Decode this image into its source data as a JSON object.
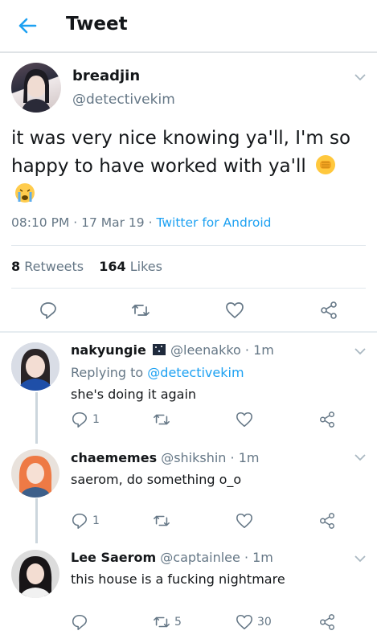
{
  "header": {
    "title": "Tweet"
  },
  "main_tweet": {
    "display_name": "breadjin",
    "handle": "@detectivekim",
    "text": "it was very nice knowing ya'll, I'm so happy to have worked with ya'll",
    "timestamp": "08:10 PM · 17 Mar 19 · ",
    "source": "Twitter for Android",
    "retweets_count": "8",
    "retweets_label": " Retweets",
    "likes_count": "164",
    "likes_label": " Likes",
    "emojis": [
      "fist-emoji",
      "crying-emoji"
    ]
  },
  "replies": [
    {
      "display_name": "nakyungie",
      "handle": "@leenakko · 1m",
      "replying_prefix": "Replying to ",
      "replying_to": "@detectivekim",
      "text": "she's doing it again",
      "reply_count": "1",
      "retweet_count": "",
      "like_count": ""
    },
    {
      "display_name": "chaememes",
      "handle": "@shikshin · 1m",
      "text": "saerom, do something o_o",
      "reply_count": "1",
      "retweet_count": "",
      "like_count": ""
    },
    {
      "display_name": "Lee Saerom",
      "handle": "@captainlee · 1m",
      "text": "this house is a fucking nightmare",
      "reply_count": "",
      "retweet_count": "5",
      "like_count": "30"
    }
  ],
  "colors": {
    "accent": "#1da1f2",
    "secondary_text": "#657786",
    "divider": "#e1e8ed"
  },
  "icons": [
    "back-arrow-icon",
    "chevron-down-icon",
    "reply-icon",
    "retweet-icon",
    "like-icon",
    "share-icon"
  ]
}
